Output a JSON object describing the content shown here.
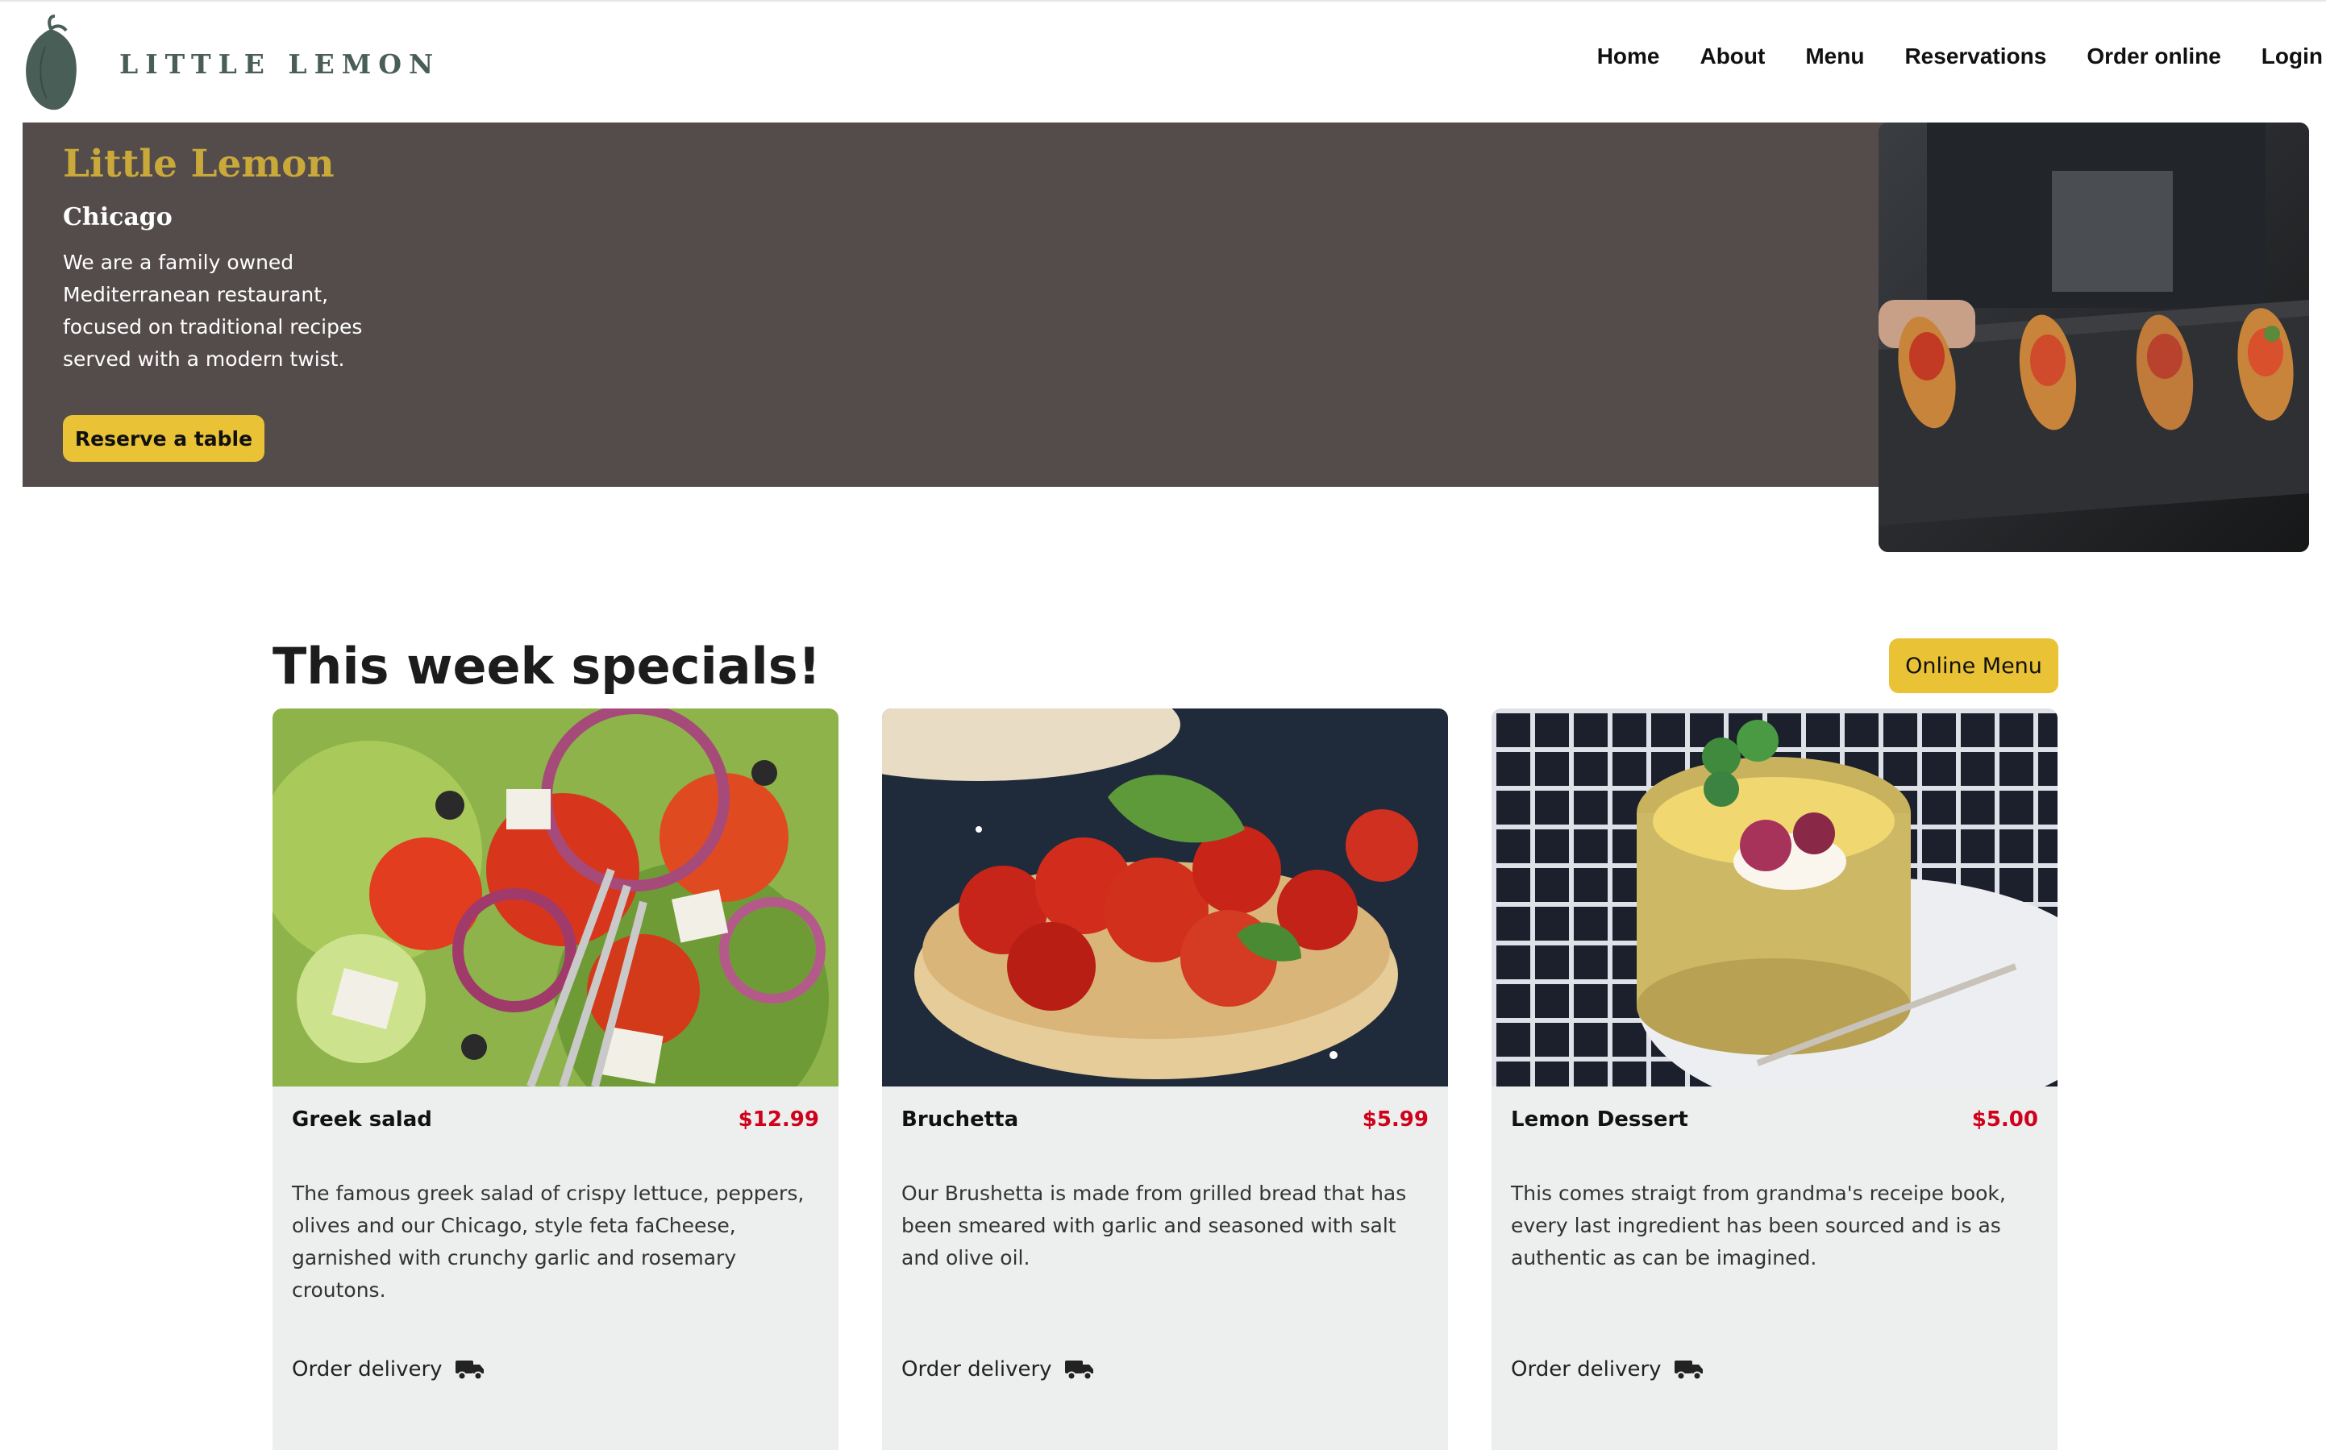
{
  "brand": {
    "name": "LITTLE LEMON",
    "color": "#495e57"
  },
  "nav": [
    {
      "label": "Home",
      "name": "nav-home"
    },
    {
      "label": "About",
      "name": "nav-about"
    },
    {
      "label": "Menu",
      "name": "nav-menu"
    },
    {
      "label": "Reservations",
      "name": "nav-reservations"
    },
    {
      "label": "Order online",
      "name": "nav-order-online"
    },
    {
      "label": "Login",
      "name": "nav-login"
    }
  ],
  "hero": {
    "title": "Little Lemon",
    "subtitle": "Chicago",
    "description": "We are a family owned Mediterranean restaurant, focused on traditional recipes served with a modern twist.",
    "button": "Reserve a table"
  },
  "specials": {
    "title": "This week specials!",
    "menu_button": "Online Menu",
    "order_label": "Order delivery",
    "items": [
      {
        "name": "Greek salad",
        "price": "$12.99",
        "description": "The famous greek salad of crispy lettuce, peppers, olives and our Chicago, style feta faCheese, garnished with crunchy garlic and rosemary croutons."
      },
      {
        "name": "Bruchetta",
        "price": "$5.99",
        "description": "Our Brushetta is made from grilled bread that has been smeared with garlic and seasoned with salt and olive oil."
      },
      {
        "name": "Lemon Dessert",
        "price": "$5.00",
        "description": "This comes straigt from grandma's receipe book, every last ingredient has been sourced and is as authentic as can be imagined."
      }
    ]
  },
  "colors": {
    "accent": "#e9c235",
    "hero_bg": "#544b4b",
    "hero_title": "#c9a93a",
    "price": "#d0021b",
    "card_bg": "#edeeee"
  }
}
